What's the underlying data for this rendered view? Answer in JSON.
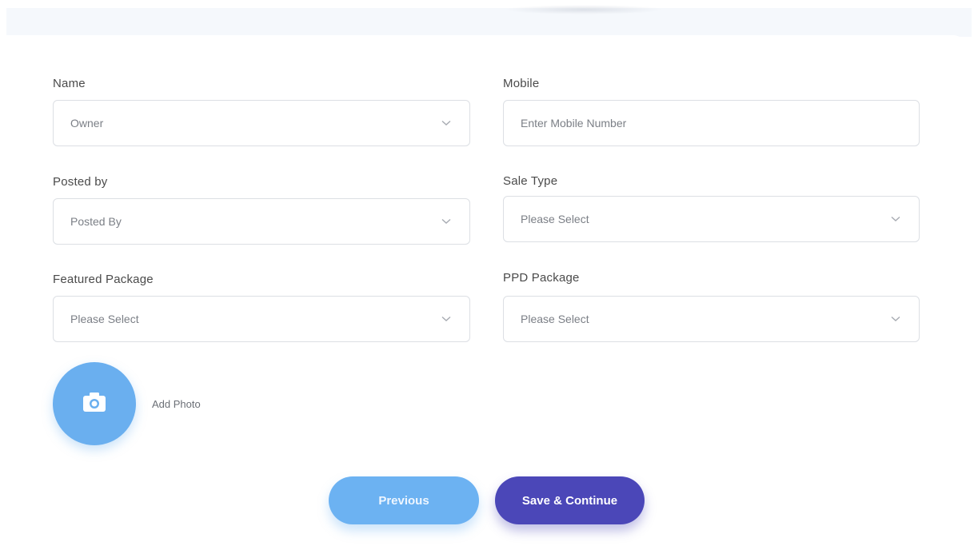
{
  "form": {
    "name": {
      "label": "Name",
      "value": "Owner"
    },
    "mobile": {
      "label": "Mobile",
      "placeholder": "Enter Mobile Number"
    },
    "posted_by": {
      "label": "Posted by",
      "value": "Posted By"
    },
    "sale_type": {
      "label": "Sale Type",
      "value": "Please Select"
    },
    "featured_package": {
      "label": "Featured Package",
      "value": "Please Select"
    },
    "ppd_package": {
      "label": "PPD Package",
      "value": "Please Select"
    }
  },
  "photo": {
    "label": "Add Photo",
    "icon": "camera-icon"
  },
  "buttons": {
    "previous": "Previous",
    "save_continue": "Save & Continue"
  },
  "colors": {
    "photo_circle": "#6aafef",
    "previous_button": "#6cb2f2",
    "save_button": "#4b47b8"
  }
}
